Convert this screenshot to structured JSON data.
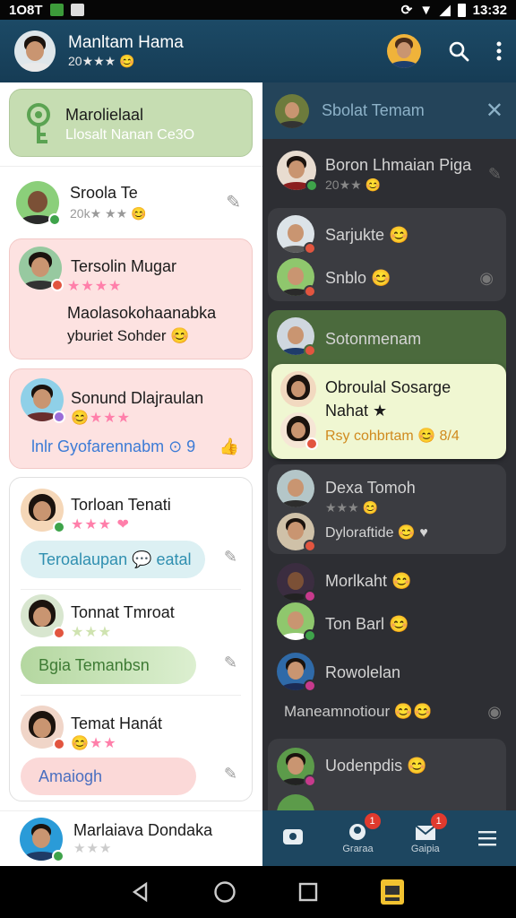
{
  "status_bar": {
    "left_text": "1O8T",
    "right_text": "13:32"
  },
  "header": {
    "name": "Manltam Hama",
    "rating": "20★★★ 😊"
  },
  "left_panel": {
    "pinned": {
      "title": "Marolielaal",
      "subtitle": "Llosalt Nanan Ce3O"
    },
    "items": [
      {
        "name": "Sroola Te",
        "meta": "20k★ ★★ 😊"
      },
      {
        "name": "Tersolin Mugar",
        "stars": "★★★★",
        "line1": "Maolasokohaanabka",
        "line2": "yburiet Sohder 😊"
      },
      {
        "name": "Sonund Dlajraulan",
        "stars": "😊★★★",
        "line": "lnlr Gyofarennabm ⊙ 9"
      },
      {
        "name": "Torloan Tenati",
        "stars": "★★★ ❤",
        "pill": "Teroalaupan 💬 eatal"
      },
      {
        "name": "Tonnat Tmroat",
        "stars": "★★★",
        "pill": "Bgia Temanbsn"
      },
      {
        "name": "Temat Hanát",
        "stars": "😊★★",
        "pill": "Amaiogh"
      },
      {
        "name": "Marlaiava Dondaka",
        "stars": "★★★"
      }
    ]
  },
  "right_panel": {
    "title": "Sbolat Temam",
    "items": [
      {
        "name": "Boron Lhmaian Piga",
        "meta": "20★★ 😊"
      },
      {
        "name": "Sarjukte 😊"
      },
      {
        "name": "Snblo 😊"
      },
      {
        "name": "Sotonmenam"
      },
      {
        "name": "Obroulal Sosarge",
        "line2": "Nahat ★",
        "line3": "Rsy cohbrtam 😊 8/4"
      },
      {
        "name": "Dexa Tomoh",
        "meta": "★★★ 😊"
      },
      {
        "name": "Dyloraftide 😊 ♥"
      },
      {
        "name": "Morlkaht 😊"
      },
      {
        "name": "Ton Barl 😊"
      },
      {
        "name": "Rowolelan"
      },
      {
        "name": "Maneamnotiour 😊😊"
      },
      {
        "name": "Uodenpdis 😊"
      }
    ]
  },
  "tabs": [
    {
      "label": "",
      "badge": ""
    },
    {
      "label": "Graraa",
      "badge": "1"
    },
    {
      "label": "Gaipia",
      "badge": "1"
    },
    {
      "label": "",
      "badge": ""
    }
  ],
  "colors": {
    "appbar": "#1c4a66",
    "pink_card": "#fde2e1",
    "green_card": "#c8deb3",
    "highlight": "#f0f7d2"
  }
}
